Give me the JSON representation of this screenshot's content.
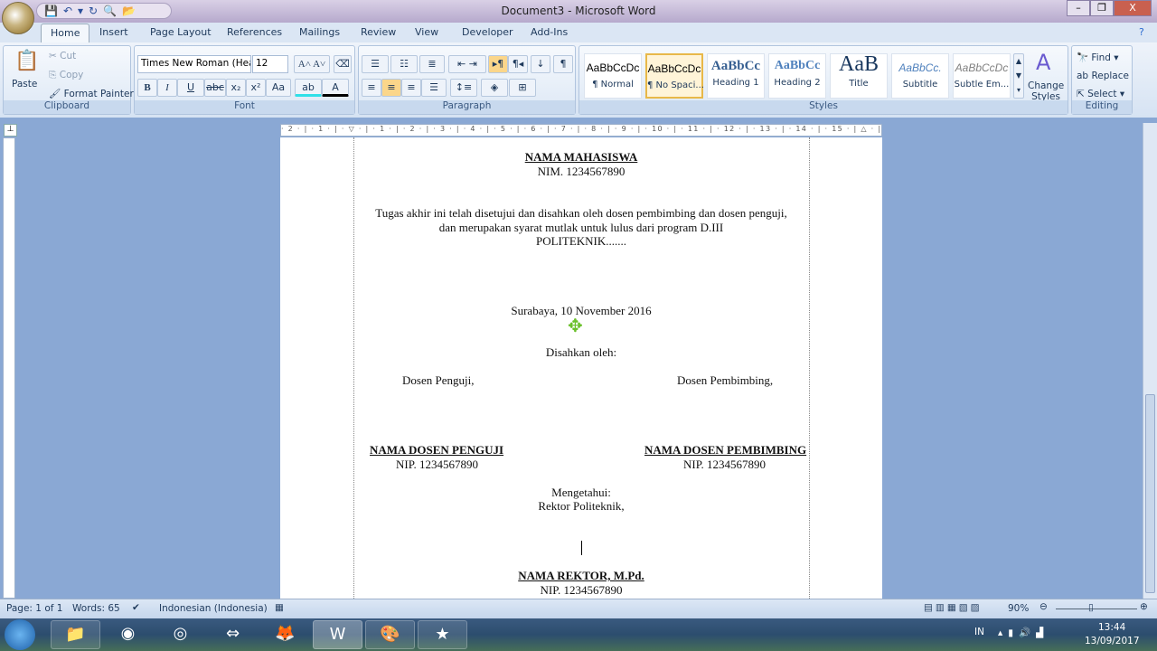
{
  "window": {
    "title": "Document3 - Microsoft Word",
    "minimize": "–",
    "restore": "❐",
    "close": "X"
  },
  "qat": [
    "💾",
    "↶",
    "▾",
    "↻",
    "🔍",
    "📂"
  ],
  "tabs": [
    "Home",
    "Insert",
    "Page Layout",
    "References",
    "Mailings",
    "Review",
    "View",
    "Developer",
    "Add-Ins"
  ],
  "clipboard": {
    "paste": "Paste",
    "cut": "Cut",
    "copy": "Copy",
    "format_painter": "Format Painter",
    "label": "Clipboard"
  },
  "font": {
    "name": "Times New Roman (Hea",
    "size": "12",
    "label": "Font",
    "bold": "B",
    "italic": "I",
    "underline": "U",
    "strike": "abc",
    "sub": "x₂",
    "sup": "x²",
    "case": "Aa",
    "grow": "A˄",
    "shrink": "A˅"
  },
  "paragraph": {
    "label": "Paragraph",
    "pilcrow": "¶"
  },
  "styles": {
    "label": "Styles",
    "items": [
      {
        "preview": "AaBbCcDc",
        "name": "¶ Normal"
      },
      {
        "preview": "AaBbCcDc",
        "name": "¶ No Spaci..."
      },
      {
        "preview": "AaBbCc",
        "name": "Heading 1"
      },
      {
        "preview": "AaBbCc",
        "name": "Heading 2"
      },
      {
        "preview": "AaB",
        "name": "Title"
      },
      {
        "preview": "AaBbCc.",
        "name": "Subtitle"
      },
      {
        "preview": "AaBbCcDc",
        "name": "Subtle Em..."
      }
    ],
    "change": "Change Styles"
  },
  "editing": {
    "label": "Editing",
    "find": "Find",
    "replace": "Replace",
    "select": "Select"
  },
  "ruler": "· 2 · | · 1 · | · ▽ · | · 1 · | · 2 · | · 3 · | · 4 · | · 5 · | · 6 · | · 7 · | · 8 · | · 9 · | · 10 · | · 11 · | · 12 · | · 13 · | · 14 · | · 15 · | △ · | · 17 · | · 18 ·",
  "document": {
    "name": "NAMA MAHASISWA",
    "nim": "NIM. 1234567890",
    "p1": "Tugas akhir ini telah disetujui dan disahkan oleh dosen pembimbing dan dosen penguji,",
    "p2": "dan merupakan syarat mutlak untuk lulus dari program D.III",
    "p3": "POLITEKNIK.......",
    "date": "Surabaya, 10 November 2016",
    "disahkan": "Disahkan oleh:",
    "penguji": "Dosen Penguji,",
    "pembimbing": "Dosen Pembimbing,",
    "penguji_name": "NAMA DOSEN PENGUJI",
    "penguji_nip": "NIP. 1234567890",
    "pembimbing_name": "NAMA DOSEN PEMBIMBING",
    "pembimbing_nip": "NIP. 1234567890",
    "mengetahui": "Mengetahui:",
    "rektor_title": "Rektor Politeknik,",
    "rektor_name": "NAMA REKTOR, M.Pd.",
    "rektor_nip": "NIP. 1234567890"
  },
  "status": {
    "page": "Page: 1 of 1",
    "words": "Words: 65",
    "language": "Indonesian (Indonesia)",
    "zoom": "90%"
  },
  "tray": {
    "lang": "IN",
    "time": "13:44",
    "date": "13/09/2017"
  }
}
